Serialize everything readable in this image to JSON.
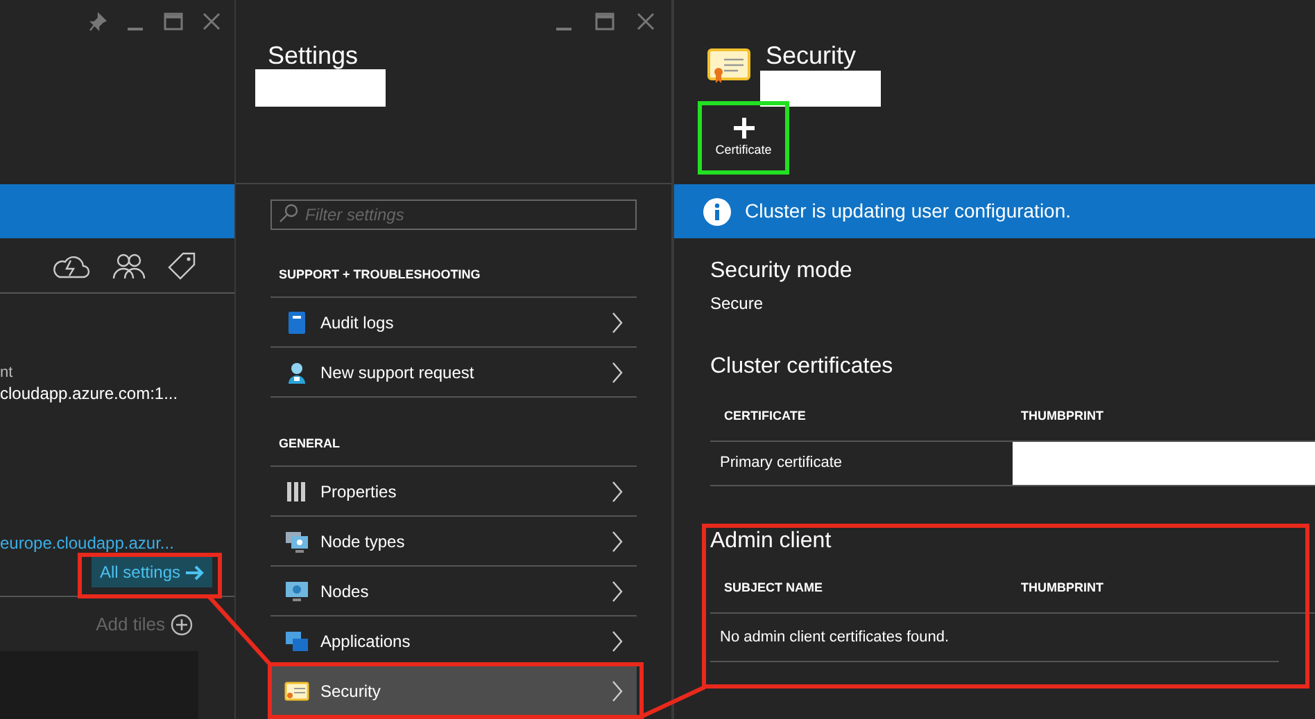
{
  "left_pane": {
    "field_label": "nt",
    "field_value": "cloudapp.azure.com:1...",
    "link": "europe.cloudapp.azur...",
    "all_settings": "All settings",
    "add_tiles": "Add tiles"
  },
  "settings_pane": {
    "title": "Settings",
    "filter_placeholder": "Filter settings",
    "sections": [
      {
        "heading": "SUPPORT + TROUBLESHOOTING",
        "items": [
          {
            "label": "Audit logs",
            "selected": false
          },
          {
            "label": "New support request",
            "selected": false
          }
        ]
      },
      {
        "heading": "GENERAL",
        "items": [
          {
            "label": "Properties",
            "selected": false
          },
          {
            "label": "Node types",
            "selected": false
          },
          {
            "label": "Nodes",
            "selected": false
          },
          {
            "label": "Applications",
            "selected": false
          },
          {
            "label": "Security",
            "selected": true
          }
        ]
      }
    ]
  },
  "security_pane": {
    "title": "Security",
    "command": "Certificate",
    "banner": "Cluster is updating user configuration.",
    "security_mode": {
      "heading": "Security mode",
      "value": "Secure"
    },
    "cluster_certificates": {
      "heading": "Cluster certificates",
      "columns": [
        "CERTIFICATE",
        "THUMBPRINT"
      ],
      "rows": [
        [
          "Primary certificate"
        ]
      ]
    },
    "admin_client": {
      "heading": "Admin client",
      "columns": [
        "SUBJECT NAME",
        "THUMBPRINT"
      ],
      "empty": "No admin client certificates found."
    }
  }
}
